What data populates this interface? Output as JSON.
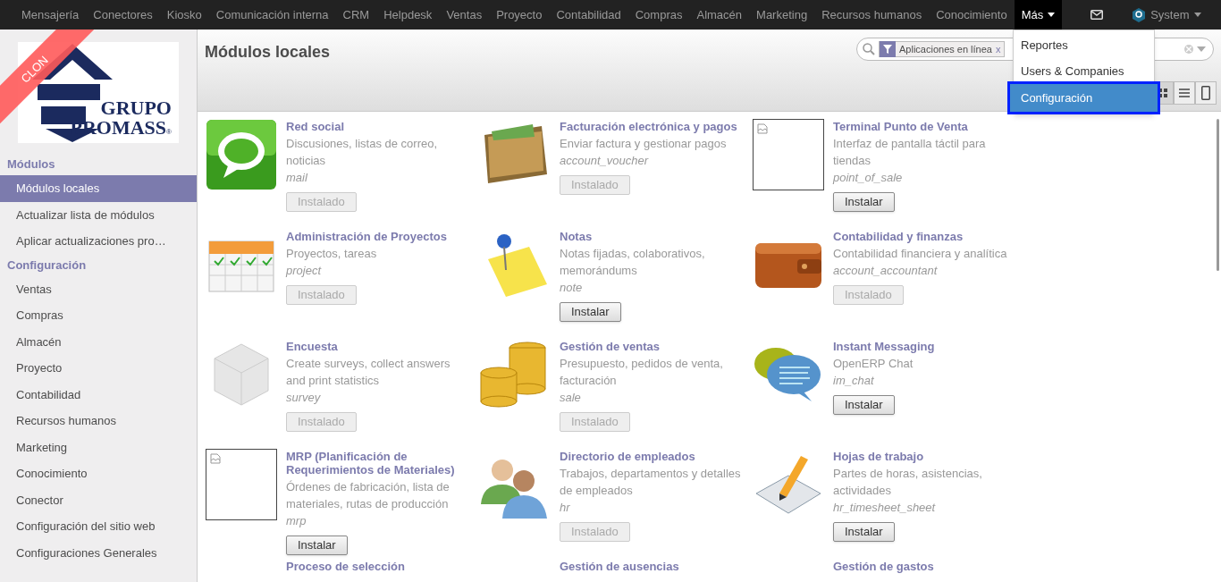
{
  "topbar": {
    "menus": [
      {
        "label": "Mensajería",
        "selected": false
      },
      {
        "label": "Conectores",
        "selected": false
      },
      {
        "label": "Kiosko",
        "selected": false
      },
      {
        "label": "Comunicación interna",
        "selected": false
      },
      {
        "label": "CRM",
        "selected": false
      },
      {
        "label": "Helpdesk",
        "selected": false
      },
      {
        "label": "Ventas",
        "selected": false
      },
      {
        "label": "Proyecto",
        "selected": false
      },
      {
        "label": "Contabilidad",
        "selected": false
      },
      {
        "label": "Compras",
        "selected": false
      },
      {
        "label": "Almacén",
        "selected": false
      },
      {
        "label": "Marketing",
        "selected": false
      },
      {
        "label": "Recursos humanos",
        "selected": false
      },
      {
        "label": "Conocimiento",
        "selected": false
      },
      {
        "label": "Más",
        "selected": true
      }
    ],
    "user": "System"
  },
  "dropdown": {
    "items": [
      {
        "label": "Reportes",
        "selected": false
      },
      {
        "label": "Users & Companies",
        "selected": false
      },
      {
        "label": "Configuración",
        "selected": true
      }
    ]
  },
  "logo": {
    "ribbon": "CLON",
    "line_1": "GRUPO",
    "line_2": "PROMASS",
    "mark": "®"
  },
  "sidebar": {
    "sections": [
      {
        "title": "Módulos",
        "items": [
          {
            "label": "Módulos locales",
            "selected": true
          },
          {
            "label": "Actualizar lista de módulos",
            "selected": false
          },
          {
            "label": "Aplicar actualizaciones pro…",
            "selected": false
          }
        ]
      },
      {
        "title": "Configuración",
        "items": [
          {
            "label": "Ventas",
            "selected": false
          },
          {
            "label": "Compras",
            "selected": false
          },
          {
            "label": "Almacén",
            "selected": false
          },
          {
            "label": "Proyecto",
            "selected": false
          },
          {
            "label": "Contabilidad",
            "selected": false
          },
          {
            "label": "Recursos humanos",
            "selected": false
          },
          {
            "label": "Marketing",
            "selected": false
          },
          {
            "label": "Conocimiento",
            "selected": false
          },
          {
            "label": "Conector",
            "selected": false
          },
          {
            "label": "Configuración del sitio web",
            "selected": false
          },
          {
            "label": "Configuraciones Generales",
            "selected": false
          }
        ]
      }
    ]
  },
  "content": {
    "title": "Módulos locales",
    "search": {
      "facet": "Aplicaciones en línea",
      "remove": "x"
    }
  },
  "modules": [
    {
      "title": "Red social",
      "description": "Discusiones, listas de correo, noticias",
      "technical_name": "mail",
      "button": "Instalado",
      "installed": true
    },
    {
      "title": "Facturación electrónica y pagos",
      "description": "Enviar factura y gestionar pagos",
      "technical_name": "account_voucher",
      "button": "Instalado",
      "installed": true
    },
    {
      "title": "Terminal Punto de Venta",
      "description": "Interfaz de pantalla táctil para tiendas",
      "technical_name": "point_of_sale",
      "button": "Instalar",
      "installed": false
    },
    {
      "title": "Administración de Proyectos",
      "description": "Proyectos, tareas",
      "technical_name": "project",
      "button": "Instalado",
      "installed": true
    },
    {
      "title": "Notas",
      "description": "Notas fijadas, colaborativos, memorándums",
      "technical_name": "note",
      "button": "Instalar",
      "installed": false
    },
    {
      "title": "Contabilidad y finanzas",
      "description": "Contabilidad financiera y analítica",
      "technical_name": "account_accountant",
      "button": "Instalado",
      "installed": true
    },
    {
      "title": "Encuesta",
      "description": "Create surveys, collect answers and print statistics",
      "technical_name": "survey",
      "button": "Instalado",
      "installed": true
    },
    {
      "title": "Gestión de ventas",
      "description": "Presupuesto, pedidos de venta, facturación",
      "technical_name": "sale",
      "button": "Instalado",
      "installed": true
    },
    {
      "title": "Instant Messaging",
      "description": "OpenERP Chat",
      "technical_name": "im_chat",
      "button": "Instalar",
      "installed": false
    },
    {
      "title": "MRP (Planificación de Requerimientos de Materiales)",
      "description": "Órdenes de fabricación, lista de materiales, rutas de producción",
      "technical_name": "mrp",
      "button": "Instalar",
      "installed": false
    },
    {
      "title": "Directorio de empleados",
      "description": "Trabajos, departamentos y detalles de empleados",
      "technical_name": "hr",
      "button": "Instalado",
      "installed": true
    },
    {
      "title": "Hojas de trabajo",
      "description": "Partes de horas, asistencias, actividades",
      "technical_name": "hr_timesheet_sheet",
      "button": "Instalar",
      "installed": false
    },
    {
      "title": "Proceso de selección"
    },
    {
      "title": "Gestión de ausencias"
    },
    {
      "title": "Gestión de gastos"
    }
  ]
}
